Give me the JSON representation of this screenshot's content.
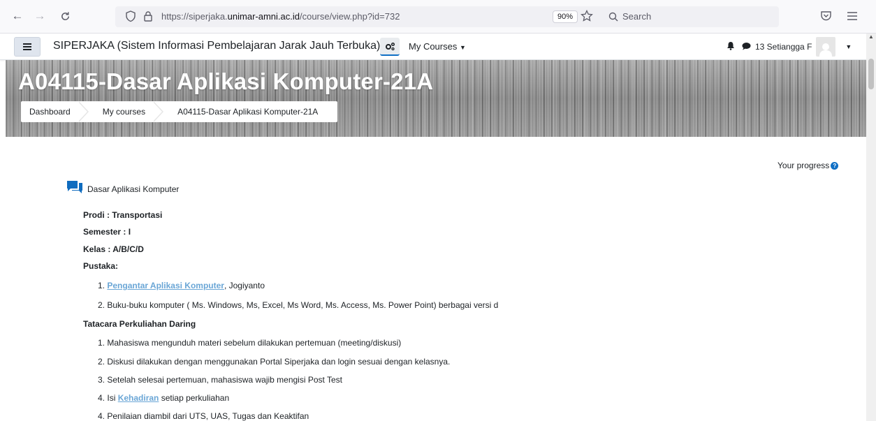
{
  "browser": {
    "url_prefix": "https://siperjaka.",
    "url_domain": "unimar-amni.ac.id",
    "url_path": "/course/view.php?id=732",
    "zoom": "90%",
    "search_placeholder": "Search"
  },
  "navbar": {
    "site_name": "SIPERJAKA (Sistem Informasi Pembelajaran Jarak Jauh Terbuka)",
    "my_courses": "My Courses",
    "user_name": "13 Setiangga F"
  },
  "header": {
    "course_title": "A04115-Dasar Aplikasi Komputer-21A",
    "breadcrumb": [
      "Dashboard",
      "My courses",
      "A04115-Dasar Aplikasi Komputer-21A"
    ]
  },
  "content": {
    "progress_label": "Your progress",
    "forum_name": "Dasar Aplikasi Komputer",
    "prodi": "Prodi : Transportasi",
    "semester": "Semester : I",
    "kelas": "Kelas : A/B/C/D",
    "pustaka_heading": "Pustaka:",
    "pustaka": [
      {
        "num": "1.",
        "link": "Pengantar Aplikasi Komputer",
        "rest": ", Jogiyanto"
      },
      {
        "num": "2.",
        "text": "Buku-buku komputer ( Ms. Windows, Ms, Excel, Ms Word, Ms. Access, Ms. Power Point) berbagai versi d"
      }
    ],
    "tatacara_heading": "Tatacara Perkuliahan Daring",
    "tatacara": [
      {
        "num": "1.",
        "text": "Mahasiswa mengunduh materi sebelum dilakukan pertemuan (meeting/diskusi)"
      },
      {
        "num": "2.",
        "text": "Diskusi dilakukan dengan menggunakan Portal Siperjaka dan login sesuai dengan kelasnya."
      },
      {
        "num": "3.",
        "text": "Setelah selesai pertemuan, mahasiswa wajib mengisi Post Test"
      },
      {
        "num": "4.",
        "pre": "Isi ",
        "link": "Kehadiran",
        "rest": " setiap perkuliahan"
      },
      {
        "num": "4.",
        "text": "Penilaian diambil dari UTS, UAS, Tugas dan Keaktifan"
      }
    ]
  }
}
